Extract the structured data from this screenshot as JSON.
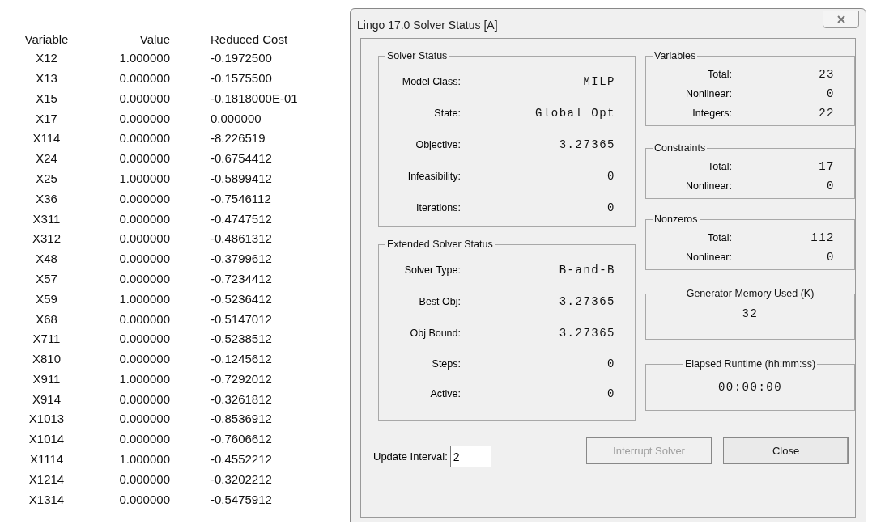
{
  "results_table": {
    "columns": [
      "Variable",
      "Value",
      "Reduced Cost"
    ],
    "rows": [
      [
        "X12",
        "1.000000",
        "-0.1972500"
      ],
      [
        "X13",
        "0.000000",
        "-0.1575500"
      ],
      [
        "X15",
        "0.000000",
        "-0.1818000E-01"
      ],
      [
        "X17",
        "0.000000",
        "0.000000"
      ],
      [
        "X114",
        "0.000000",
        "-8.226519"
      ],
      [
        "X24",
        "0.000000",
        "-0.6754412"
      ],
      [
        "X25",
        "1.000000",
        "-0.5899412"
      ],
      [
        "X36",
        "0.000000",
        "-0.7546112"
      ],
      [
        "X311",
        "0.000000",
        "-0.4747512"
      ],
      [
        "X312",
        "0.000000",
        "-0.4861312"
      ],
      [
        "X48",
        "0.000000",
        "-0.3799612"
      ],
      [
        "X57",
        "0.000000",
        "-0.7234412"
      ],
      [
        "X59",
        "1.000000",
        "-0.5236412"
      ],
      [
        "X68",
        "0.000000",
        "-0.5147012"
      ],
      [
        "X711",
        "0.000000",
        "-0.5238512"
      ],
      [
        "X810",
        "0.000000",
        "-0.1245612"
      ],
      [
        "X911",
        "1.000000",
        "-0.7292012"
      ],
      [
        "X914",
        "0.000000",
        "-0.3261812"
      ],
      [
        "X1013",
        "0.000000",
        "-0.8536912"
      ],
      [
        "X1014",
        "0.000000",
        "-0.7606612"
      ],
      [
        "X1114",
        "1.000000",
        "-0.4552212"
      ],
      [
        "X1214",
        "0.000000",
        "-0.3202212"
      ],
      [
        "X1314",
        "0.000000",
        "-0.5475912"
      ]
    ]
  },
  "dialog": {
    "title": "Lingo 17.0 Solver Status [A]",
    "solver_status": {
      "title": "Solver Status",
      "fields": [
        {
          "label": "Model Class:",
          "value": "MILP"
        },
        {
          "label": "State:",
          "value": "Global Opt"
        },
        {
          "label": "Objective:",
          "value": "3.27365"
        },
        {
          "label": "Infeasibility:",
          "value": "0"
        },
        {
          "label": "Iterations:",
          "value": "0"
        }
      ]
    },
    "extended_solver_status": {
      "title": "Extended Solver Status",
      "fields": [
        {
          "label": "Solver Type:",
          "value": "B-and-B"
        },
        {
          "label": "Best Obj:",
          "value": "3.27365"
        },
        {
          "label": "Obj Bound:",
          "value": "3.27365"
        },
        {
          "label": "Steps:",
          "value": "0"
        },
        {
          "label": "Active:",
          "value": "0"
        }
      ]
    },
    "variables": {
      "title": "Variables",
      "fields": [
        {
          "label": "Total:",
          "value": "23"
        },
        {
          "label": "Nonlinear:",
          "value": "0"
        },
        {
          "label": "Integers:",
          "value": "22"
        }
      ]
    },
    "constraints": {
      "title": "Constraints",
      "fields": [
        {
          "label": "Total:",
          "value": "17"
        },
        {
          "label": "Nonlinear:",
          "value": "0"
        }
      ]
    },
    "nonzeros": {
      "title": "Nonzeros",
      "fields": [
        {
          "label": "Total:",
          "value": "112"
        },
        {
          "label": "Nonlinear:",
          "value": "0"
        }
      ]
    },
    "generator_memory": {
      "title": "Generator Memory Used (K)",
      "value": "32"
    },
    "elapsed_runtime": {
      "title": "Elapsed Runtime (hh:mm:ss)",
      "value": "00:00:00"
    },
    "update_interval": {
      "label": "Update Interval:",
      "value": "2"
    },
    "buttons": [
      {
        "label": "Interrupt Solver",
        "disabled": true
      },
      {
        "label": "Close",
        "disabled": false
      }
    ]
  }
}
